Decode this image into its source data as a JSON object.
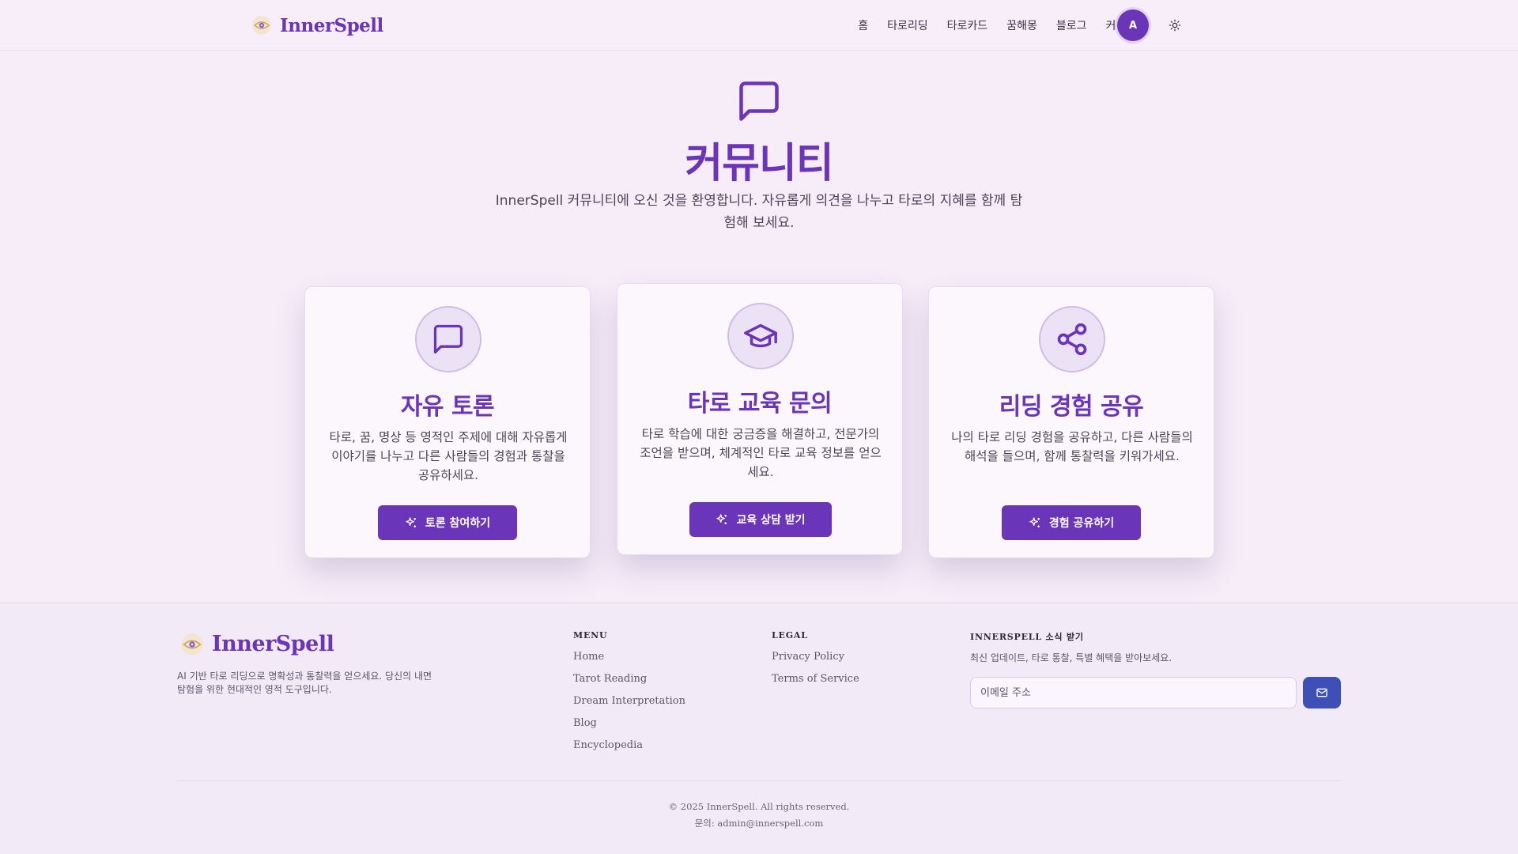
{
  "header": {
    "brand": "InnerSpell",
    "nav": [
      "홈",
      "타로리딩",
      "타로카드",
      "꿈해몽",
      "블로그",
      "커뮤니티"
    ],
    "avatar_initial": "A",
    "theme_icon": "sun-icon"
  },
  "hero": {
    "icon": "message-square-icon",
    "title": "커뮤니티",
    "subtitle": "InnerSpell 커뮤니티에 오신 것을 환영합니다. 자유롭게 의견을 나누고 타로의 지혜를 함께 탐험해 보세요."
  },
  "cards": [
    {
      "icon": "message-square-icon",
      "title": "자유 토론",
      "description": "타로, 꿈, 명상 등 영적인 주제에 대해 자유롭게 이야기를 나누고 다른 사람들의 경험과 통찰을 공유하세요.",
      "button": "토론 참여하기",
      "button_icon": "sparkles-icon"
    },
    {
      "icon": "graduation-cap-icon",
      "title": "타로 교육 문의",
      "description": "타로 학습에 대한 궁금증을 해결하고, 전문가의 조언을 받으며, 체계적인 타로 교육 정보를 얻으세요.",
      "button": "교육 상담 받기",
      "button_icon": "sparkles-icon"
    },
    {
      "icon": "share-icon",
      "title": "리딩 경험 공유",
      "description": "나의 타로 리딩 경험을 공유하고, 다른 사람들의 해석을 들으며, 함께 통찰력을 키워가세요.",
      "button": "경험 공유하기",
      "button_icon": "sparkles-icon"
    }
  ],
  "footer": {
    "brand": "InnerSpell",
    "description": "AI 기반 타로 리딩으로 명확성과 통찰력을 얻으세요. 당신의 내면 탐험을 위한 현대적인 영적 도구입니다.",
    "menu_heading": "MENU",
    "menu_links": [
      "Home",
      "Tarot Reading",
      "Dream Interpretation",
      "Blog",
      "Encyclopedia"
    ],
    "legal_heading": "LEGAL",
    "legal_links": [
      "Privacy Policy",
      "Terms of Service"
    ],
    "newsletter_heading": "INNERSPELL 소식 받기",
    "newsletter_desc": "최신 업데이트, 타로 통찰, 특별 혜택을 받아보세요.",
    "email_placeholder": "이메일 주소",
    "subscribe_icon": "mail-icon",
    "copyright": "© 2025 InnerSpell. All rights reserved.",
    "contact": "문의: admin@innerspell.com"
  },
  "colors": {
    "primary": "#6a35b8",
    "background": "#f6edf9",
    "card_bg": "#fcf7fd",
    "subscribe_button": "#3f4fb8"
  }
}
